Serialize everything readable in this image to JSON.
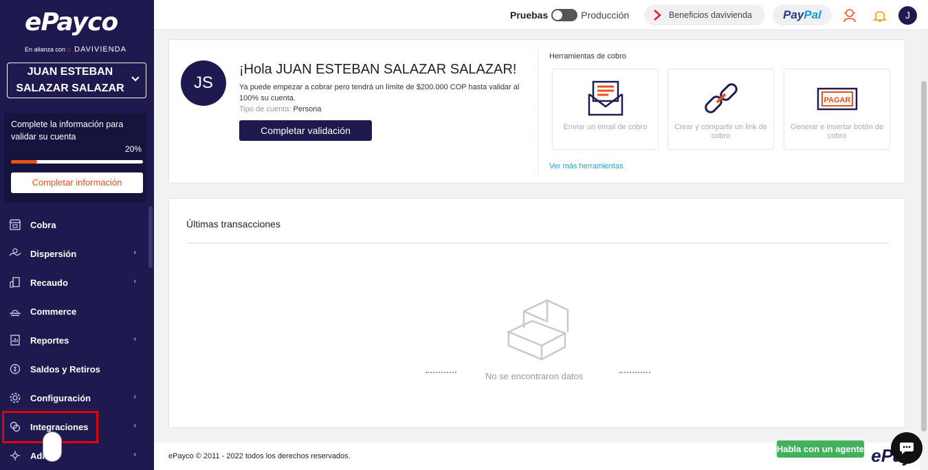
{
  "sidebar": {
    "logo": "ePayco",
    "alianza_prefix": "En alianza con",
    "alianza_brand": "DAVIVIENDA",
    "account_name": "JUAN ESTEBAN SALAZAR SALAZAR",
    "complete_text": "Complete la información para validar su cuenta",
    "progress_label": "20%",
    "progress_value": 20,
    "complete_button": "Completar información",
    "items": [
      {
        "label": "Cobra",
        "icon": "store-icon",
        "chevron": false
      },
      {
        "label": "Dispersión",
        "icon": "dispersion-icon",
        "chevron": true
      },
      {
        "label": "Recaudo",
        "icon": "recaudo-icon",
        "chevron": true
      },
      {
        "label": "Commerce",
        "icon": "commerce-icon",
        "chevron": false
      },
      {
        "label": "Reportes",
        "icon": "reports-icon",
        "chevron": true
      },
      {
        "label": "Saldos y Retiros",
        "icon": "wallet-icon",
        "chevron": false
      },
      {
        "label": "Configuración",
        "icon": "gear-icon",
        "chevron": true
      },
      {
        "label": "Integraciones",
        "icon": "integrations-icon",
        "chevron": true
      },
      {
        "label": "Admin",
        "icon": "admin-icon",
        "chevron": true
      }
    ]
  },
  "topbar": {
    "env_test": "Pruebas",
    "env_prod": "Producción",
    "benefits": "Beneficios davivienda",
    "paypal_pay": "Pay",
    "paypal_pal": "Pal",
    "avatar": "J"
  },
  "welcome": {
    "avatar": "JS",
    "greeting": "¡Hola JUAN ESTEBAN SALAZAR SALAZAR!",
    "subtitle": "Ya puede empezar a cobrar pero tendrá un límite de $200.000 COP hasta validar al 100% su cuenta.",
    "account_type_label": "Tipo de cuenta:",
    "account_type_value": "Persona",
    "validate_button": "Completar validación",
    "tools_title": "Herramientas de cobro",
    "tools": [
      {
        "label": "Enviar un email de cobro",
        "icon": "email-invoice-icon"
      },
      {
        "label": "Crear y compartir un link de cobro",
        "icon": "chain-link-icon"
      },
      {
        "label": "Generar e insertar botón de cobro",
        "icon": "pay-button-icon"
      }
    ],
    "pay_button_text": "PAGAR",
    "more_tools": "Ver más herramientas"
  },
  "transactions": {
    "title": "Últimas transacciones",
    "empty": "No se encontraron datos"
  },
  "footer": {
    "copyright": "ePayco © 2011 - 2022 todos los derechos reservados.",
    "logo": "ePay",
    "agent_button": "Habla con un agente"
  },
  "colors": {
    "sidebar_bg": "#1e1a4f",
    "accent": "#e8501c",
    "link": "#1ba1d6",
    "agent_green": "#43b05c",
    "highlight": "#e50000"
  }
}
